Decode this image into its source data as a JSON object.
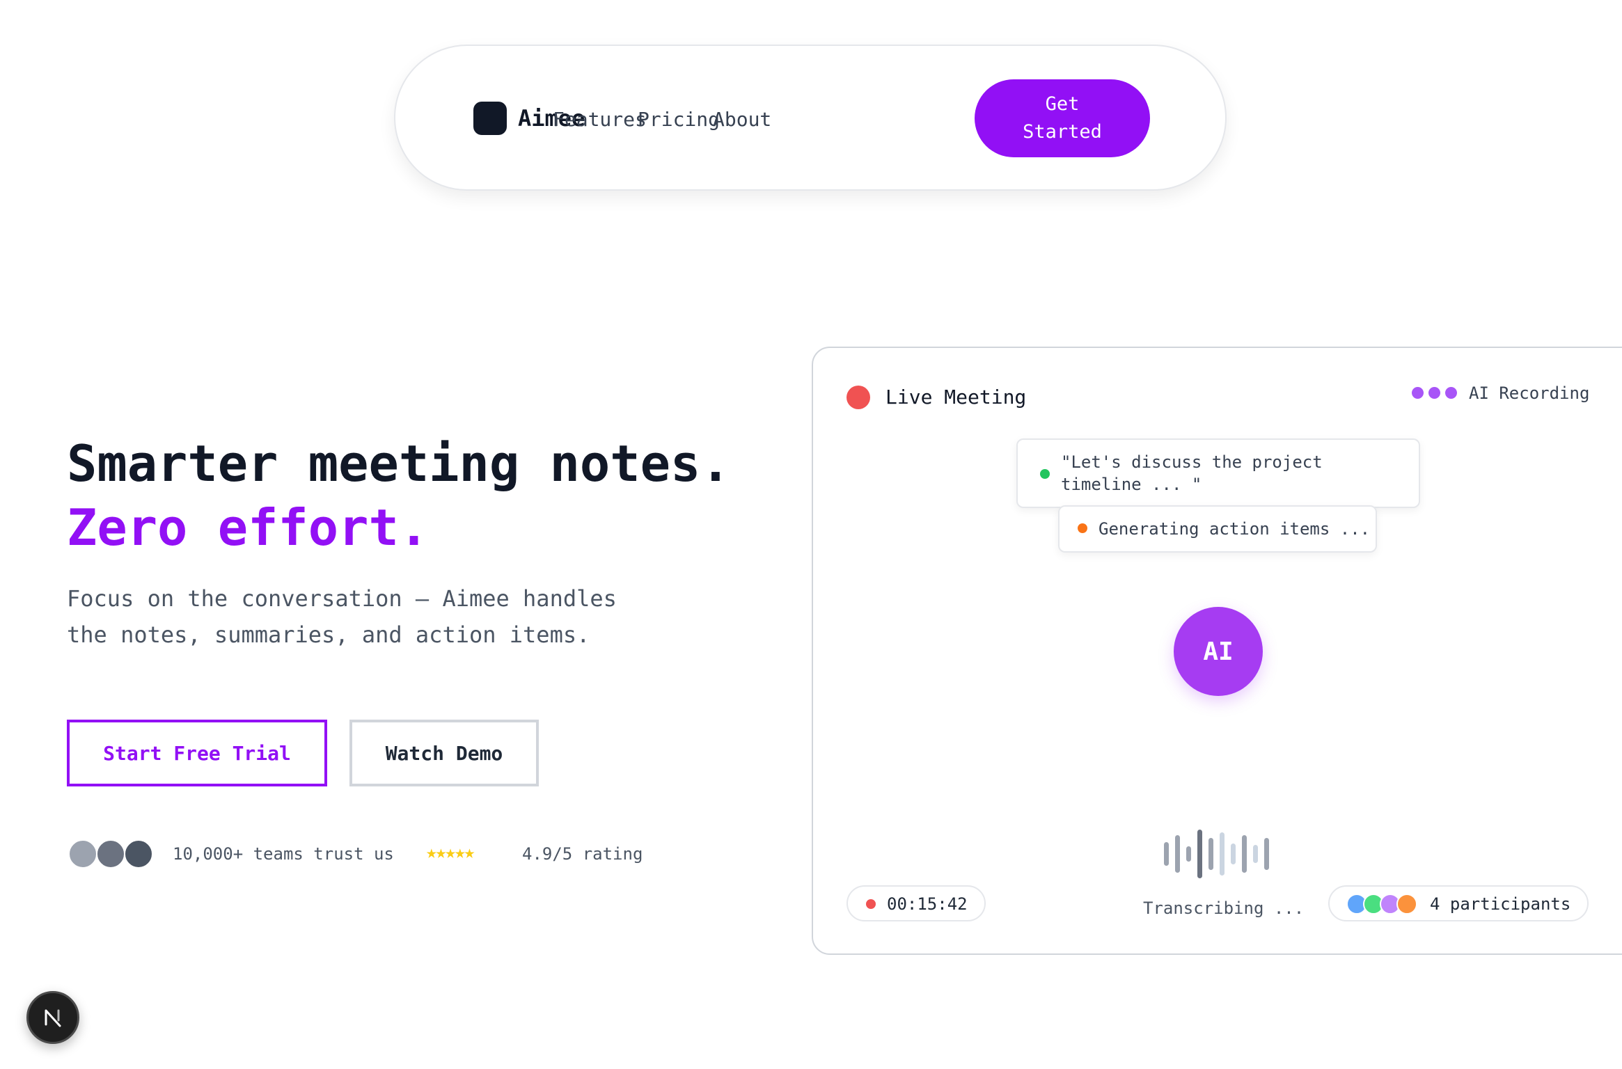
{
  "nav": {
    "brand": "Aimee",
    "links": [
      "Features",
      "Pricing",
      "About"
    ],
    "cta": "Get Started"
  },
  "hero": {
    "title_line1": "Smarter meeting notes.",
    "title_line2": "Zero effort.",
    "subtitle": "Focus on the conversation — Aimee handles the notes, summaries, and action items.",
    "primary_button": "Start Free Trial",
    "secondary_button": "Watch Demo",
    "trust_text": "10,000+ teams trust us",
    "stars": "★★★★★",
    "rating_text": "4.9/5 rating"
  },
  "card": {
    "title": "Live Meeting",
    "recording_label": "AI Recording",
    "bubble_1": "\"Let's discuss the project timeline ... \"",
    "bubble_2": "Generating action items ...",
    "ai_label": "AI",
    "status": "Transcribing ...",
    "timer": "00:15:42",
    "participants": "4 participants"
  },
  "colors": {
    "accent": "#9210f5",
    "orb": "#a63cf2",
    "live": "#f05252",
    "success": "#22c55e",
    "warning": "#f97316",
    "star": "#facc15"
  },
  "icons": [
    "logo-mark-icon",
    "live-dot-icon",
    "recording-dots-icon",
    "audio-waveform-icon",
    "nextjs-icon"
  ]
}
